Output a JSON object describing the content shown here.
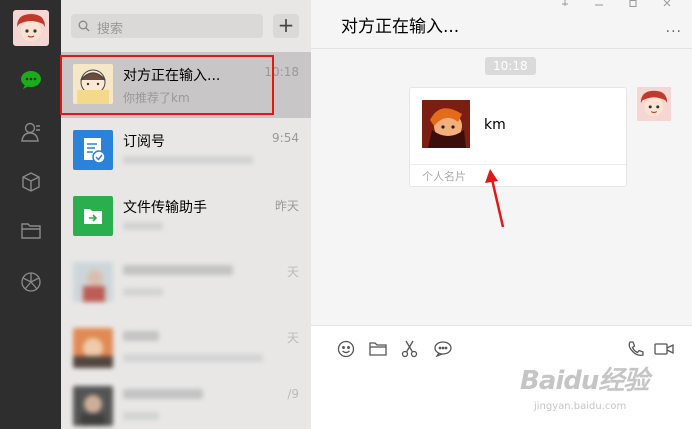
{
  "search": {
    "placeholder": "搜索",
    "add_label": "+"
  },
  "chats": [
    {
      "name": "对方正在输入...",
      "preview": "你推荐了km",
      "time": "10:18",
      "selected": true
    },
    {
      "name": "订阅号",
      "preview": "",
      "time": "9:54"
    },
    {
      "name": "文件传输助手",
      "preview": "",
      "time": "昨天"
    },
    {
      "name": "",
      "preview": "",
      "time": "天",
      "blurred": true
    },
    {
      "name": "",
      "preview": "",
      "time": "天",
      "blurred": true
    },
    {
      "name": "",
      "preview": "",
      "time": "/9",
      "blurred": true
    }
  ],
  "conversation": {
    "title": "对方正在输入...",
    "more_label": "···",
    "timestamp": "10:18",
    "card": {
      "name": "km",
      "footer": "个人名片"
    }
  },
  "colors": {
    "rail": "#2e2e2e",
    "active": "#1aad19",
    "highlight": "#e01818",
    "list_bg": "#e8e7e6",
    "selected_bg": "#c8c6c6"
  },
  "watermark": {
    "brand": "Baidu经验",
    "url": "jingyan.baidu.com"
  }
}
